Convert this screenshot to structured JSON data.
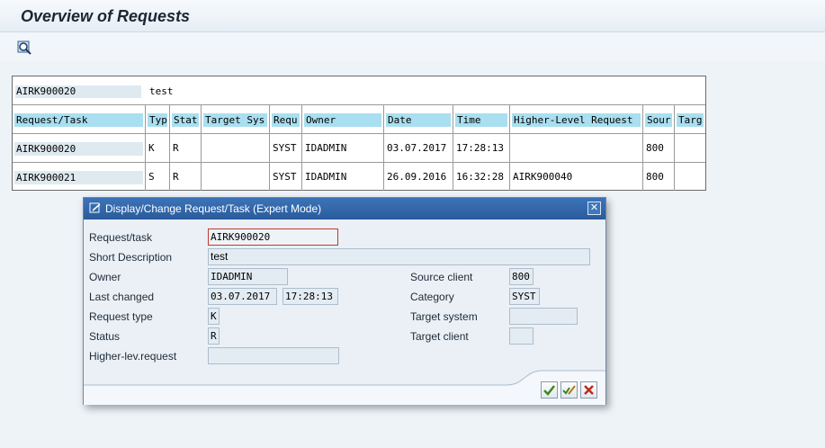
{
  "window": {
    "title": "Overview of Requests"
  },
  "toolbar": {
    "icons": [
      "find-icon"
    ]
  },
  "grid": {
    "header": {
      "request": "AIRK900020",
      "description": "test"
    },
    "columns": [
      "Request/Task",
      "Typ",
      "Stat",
      "Target Sys",
      "Requ",
      "Owner",
      "Date",
      "Time",
      "Higher-Level Request",
      "Sour",
      "Targ"
    ],
    "rows": [
      [
        "AIRK900020",
        "K",
        "R",
        "",
        "SYST",
        "IDADMIN",
        "03.07.2017",
        "17:28:13",
        "",
        "800",
        ""
      ],
      [
        "AIRK900021",
        "S",
        "R",
        "",
        "SYST",
        "IDADMIN",
        "26.09.2016",
        "16:32:28",
        "AIRK900040",
        "800",
        ""
      ]
    ]
  },
  "dialog": {
    "title": "Display/Change Request/Task (Expert Mode)",
    "labels": {
      "request_task": "Request/task",
      "short_description": "Short Description",
      "owner": "Owner",
      "last_changed": "Last changed",
      "request_type": "Request type",
      "status": "Status",
      "higher_lev_request": "Higher-lev.request",
      "source_client": "Source client",
      "category": "Category",
      "target_system": "Target system",
      "target_client": "Target client"
    },
    "values": {
      "request_task": "AIRK900020",
      "short_description": "test",
      "owner": "IDADMIN",
      "last_changed_date": "03.07.2017",
      "last_changed_time": "17:28:13",
      "request_type": "K",
      "status": "R",
      "higher_lev_request": "",
      "source_client": "800",
      "category": "SYST",
      "target_system": "",
      "target_client": ""
    },
    "buttons": [
      "confirm-icon",
      "edit-icon",
      "cancel-icon"
    ],
    "colors": {
      "title_bar": "#2f64a8",
      "confirm": "#3a8a1f",
      "cancel": "#c0281f"
    }
  }
}
